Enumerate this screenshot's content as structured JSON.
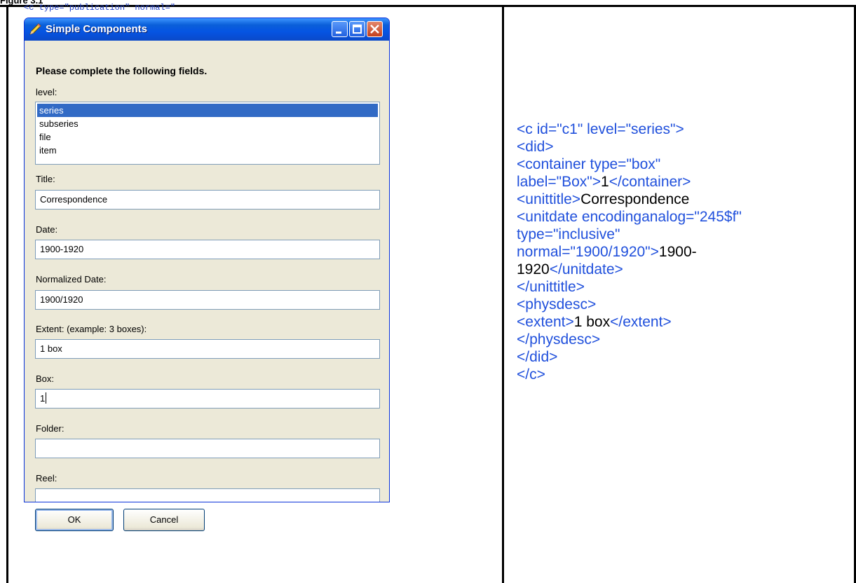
{
  "figure_label": "Figure 3.1",
  "background_xml": "<c type=\"publication\" normal=\"",
  "window": {
    "title": "Simple Components",
    "instruction": "Please complete the following fields.",
    "level": {
      "label": "level:",
      "options": [
        "series",
        "subseries",
        "file",
        "item"
      ],
      "selected": "series"
    },
    "fields": [
      {
        "label": "Title:",
        "value": "Correspondence"
      },
      {
        "label": "Date:",
        "value": "1900-1920"
      },
      {
        "label": "Normalized Date:",
        "value": "1900/1920"
      },
      {
        "label": "Extent: (example: 3 boxes):",
        "value": "1 box"
      },
      {
        "label": "Box:",
        "value": "1"
      },
      {
        "label": "Folder:",
        "value": ""
      },
      {
        "label": "Reel:",
        "value": ""
      }
    ],
    "buttons": {
      "ok": "OK",
      "cancel": "Cancel"
    }
  },
  "xml": {
    "l1": "<c id=\"c1\" level=\"series\">",
    "l2": "<did>",
    "l3": "<container type=\"box\"",
    "l4a": "label=\"Box\">",
    "l4b": "1",
    "l4c": "</container>",
    "l5a": "<unittitle>",
    "l5b": "Correspondence",
    "l6": "<unitdate encodinganalog=\"245$f\"",
    "l7": "type=\"inclusive\"",
    "l8a": "normal=\"1900/1920\">",
    "l8b": "1900-",
    "l9a": "1920",
    "l9b": "</unitdate>",
    "l10": "</unittitle>",
    "l11": "<physdesc>",
    "l12a": "<extent>",
    "l12b": "1 box",
    "l12c": "</extent>",
    "l13": "</physdesc>",
    "l14": "</did>",
    "l15": "</c>"
  }
}
